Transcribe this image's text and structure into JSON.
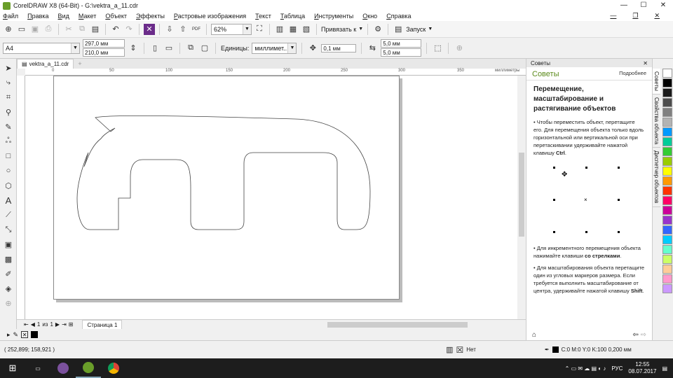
{
  "window": {
    "title": "CorelDRAW X8 (64-Bit) - G:\\vektra_a_11.cdr"
  },
  "menu": [
    "Файл",
    "Правка",
    "Вид",
    "Макет",
    "Объект",
    "Эффекты",
    "Растровые изображения",
    "Текст",
    "Таблица",
    "Инструменты",
    "Окно",
    "Справка"
  ],
  "toolbar": {
    "zoom": "62%",
    "snap_label": "Привязать к",
    "launch_label": "Запуск",
    "pdf": "PDF"
  },
  "propbar": {
    "page_size": "A4",
    "width": "297,0 мм",
    "height": "210,0 мм",
    "units_label": "Единицы:",
    "units": "миллимет...",
    "nudge": "0,1 мм",
    "dup_x": "5,0 мм",
    "dup_y": "5,0 мм"
  },
  "doc": {
    "tab": "vektra_a_11.cdr",
    "ruler_ticks": [
      "0",
      "50",
      "100",
      "150",
      "200",
      "250",
      "300",
      "350"
    ],
    "ruler_units": "миллиметры"
  },
  "pagenav": {
    "current": "1",
    "of_label": "из",
    "total": "1",
    "page_tab": "Страница 1"
  },
  "docker": {
    "header": "Советы",
    "title": "Советы",
    "more": "Подробнее",
    "heading": "Перемещение, масштабирование и растягивание объектов",
    "tip1": "Чтобы переместить объект, перетащите его. Для перемещения объекта только вдоль горизонтальной или вертикальной оси при перетаскивании удерживайте нажатой клавишу",
    "tip1_key": "Ctrl",
    "tip2": "Для инкрементного перемещения объекта нажимайте клавиши",
    "tip2_key": "со стрелками",
    "tip3": "Для масштабирования объекта перетащите один из угловых маркеров размера. Если требуется выполнить масштабирование от центра, удерживайте нажатой клавишу",
    "tip3_key": "Shift"
  },
  "vtabs": [
    "Советы",
    "Свойства объекта",
    "Диспетчер объектов"
  ],
  "status": {
    "coords": "( 252,899; 158,921 )",
    "fill": "Нет",
    "outline": "C:0 M:0 Y:0 K:100  0,200 мм"
  },
  "taskbar": {
    "lang": "РУС",
    "time": "12:55",
    "date": "08.07.2017"
  },
  "colors": {
    "swatches": [
      "#ffffff",
      "#000000",
      "#1a1a1a",
      "#4d4d4d",
      "#808080",
      "#b3b3b3",
      "#0099ff",
      "#00cc99",
      "#33cc33",
      "#99cc00",
      "#ffff00",
      "#ff9900",
      "#ff3300",
      "#ff0066",
      "#cc0099",
      "#9933cc",
      "#3366ff",
      "#00ccff",
      "#66ffcc",
      "#ccff66",
      "#ffcc99",
      "#ff99cc",
      "#cc99ff"
    ]
  }
}
